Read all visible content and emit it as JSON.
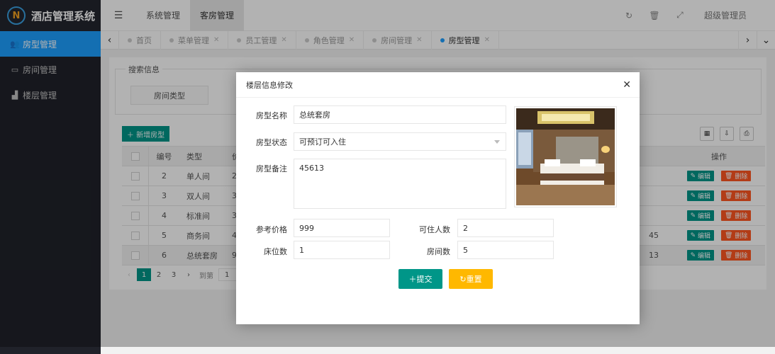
{
  "app": {
    "title": "酒店管理系统"
  },
  "sidebar": {
    "items": [
      {
        "label": "房型管理",
        "icon": "users-icon"
      },
      {
        "label": "房间管理",
        "icon": "bed-icon"
      },
      {
        "label": "楼层管理",
        "icon": "building-icon"
      }
    ]
  },
  "header": {
    "nav": [
      "系统管理",
      "客房管理"
    ],
    "admin": "超级管理员"
  },
  "tabs": [
    "首页",
    "菜单管理",
    "员工管理",
    "角色管理",
    "房间管理",
    "房型管理"
  ],
  "search": {
    "legend": "搜索信息",
    "label": "房间类型"
  },
  "toolbar": {
    "add": "新增房型"
  },
  "table": {
    "headers": {
      "id": "编号",
      "type": "类型",
      "price": "价",
      "action": "操作"
    },
    "rows": [
      {
        "id": "2",
        "type": "单人间",
        "price": "20",
        "extra": ""
      },
      {
        "id": "3",
        "type": "双人间",
        "price": "30",
        "extra": ""
      },
      {
        "id": "4",
        "type": "标准间",
        "price": "30",
        "extra": ""
      },
      {
        "id": "5",
        "type": "商务间",
        "price": "40",
        "extra": "45"
      },
      {
        "id": "6",
        "type": "总统套房",
        "price": "99",
        "extra": "13"
      }
    ],
    "edit": "编辑",
    "delete": "删除"
  },
  "pager": {
    "pages": [
      "1",
      "2",
      "3"
    ],
    "goto": "到第",
    "goto_value": "1"
  },
  "modal": {
    "title": "楼层信息修改",
    "fields": {
      "name_label": "房型名称",
      "name_value": "总统套房",
      "status_label": "房型状态",
      "status_value": "可预订可入住",
      "note_label": "房型备注",
      "note_value": "45613",
      "price_label": "参考价格",
      "price_value": "999",
      "capacity_label": "可住人数",
      "capacity_value": "2",
      "beds_label": "床位数",
      "beds_value": "1",
      "rooms_label": "房间数",
      "rooms_value": "5"
    },
    "submit": "提交",
    "reset": "重置"
  },
  "colors": {
    "primary": "#009688",
    "blue": "#1e9fff",
    "danger": "#ff5722",
    "warn": "#ffb800",
    "sidebar": "#20222a"
  }
}
